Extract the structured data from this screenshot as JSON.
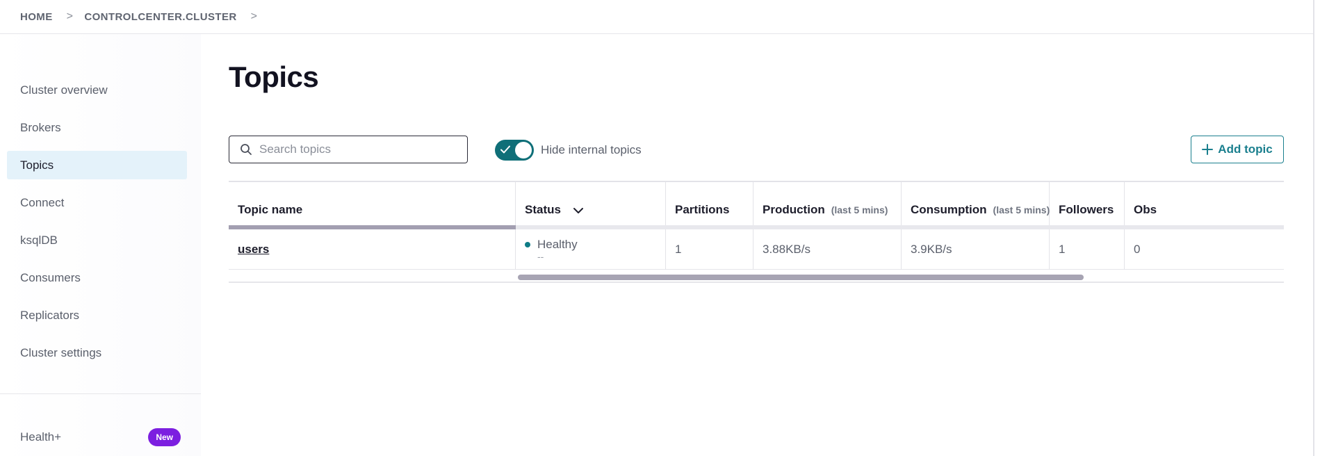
{
  "breadcrumb": {
    "home": "HOME",
    "cluster": "CONTROLCENTER.CLUSTER",
    "separator": ">"
  },
  "sidebar": {
    "items": [
      {
        "label": "Cluster overview"
      },
      {
        "label": "Brokers"
      },
      {
        "label": "Topics",
        "active": true
      },
      {
        "label": "Connect"
      },
      {
        "label": "ksqlDB"
      },
      {
        "label": "Consumers"
      },
      {
        "label": "Replicators"
      },
      {
        "label": "Cluster settings"
      }
    ],
    "health": {
      "label": "Health+",
      "badge": "New"
    }
  },
  "main": {
    "title": "Topics",
    "search": {
      "placeholder": "Search topics",
      "value": ""
    },
    "toggle": {
      "label": "Hide internal topics",
      "on": true
    },
    "add_button": "Add topic"
  },
  "table": {
    "columns": [
      {
        "label": "Topic name",
        "sub": ""
      },
      {
        "label": "Status",
        "sub": ""
      },
      {
        "label": "Partitions",
        "sub": ""
      },
      {
        "label": "Production",
        "sub": "(last 5 mins)"
      },
      {
        "label": "Consumption",
        "sub": "(last 5 mins)"
      },
      {
        "label": "Followers",
        "sub": ""
      },
      {
        "label": "Obs",
        "sub": ""
      }
    ],
    "rows": [
      {
        "topic": "users",
        "status": "Healthy",
        "status_sub": "--",
        "partitions": "1",
        "production": "3.88KB/s",
        "consumption": "3.9KB/s",
        "followers": "1",
        "obs": "0"
      }
    ]
  },
  "colors": {
    "accent": "#1a7f8e",
    "toggle": "#0f6f78",
    "healthy": "#0e7c86",
    "badge": "#7c1fe0",
    "active_nav": "#e4f2fa"
  }
}
